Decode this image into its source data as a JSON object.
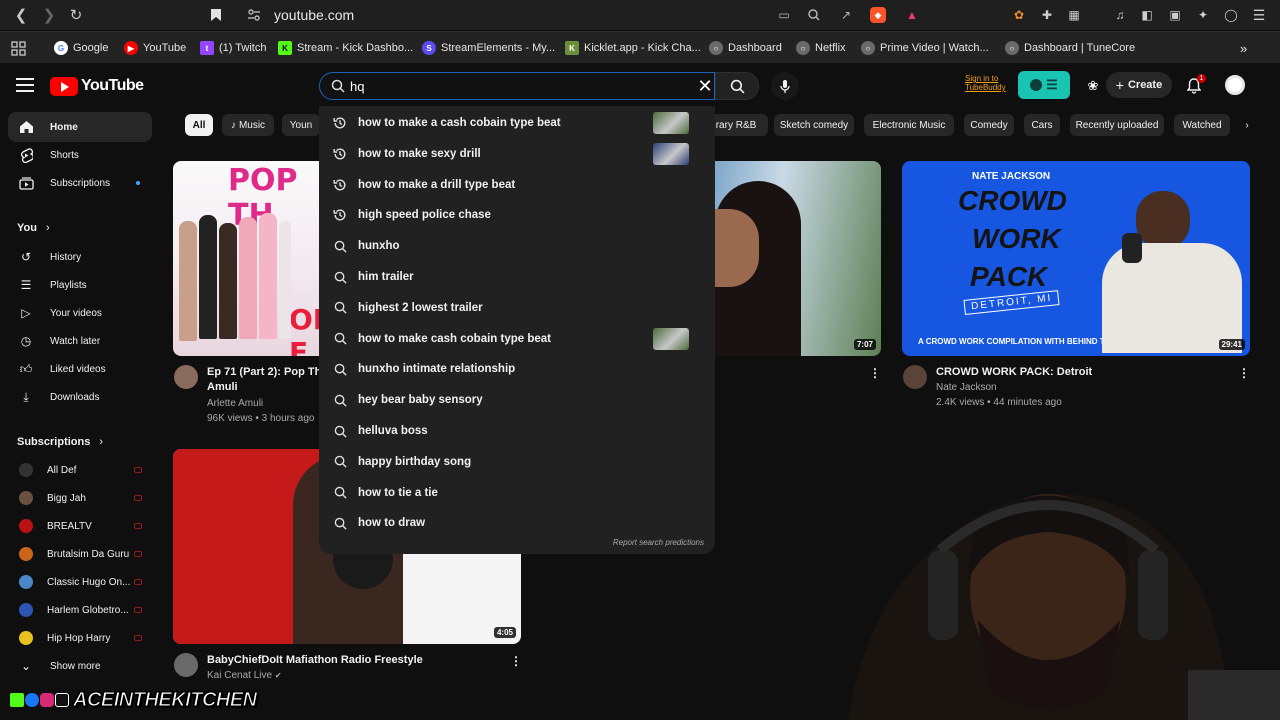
{
  "browser": {
    "url": "youtube.com",
    "bookmarks": [
      {
        "label": "Google",
        "color": "#4285f4",
        "icon": "google-icon"
      },
      {
        "label": "YouTube",
        "color": "#ff0000",
        "icon": "youtube-icon"
      },
      {
        "label": "(1) Twitch",
        "color": "#9146ff",
        "icon": "twitch-icon"
      },
      {
        "label": "Stream - Kick Dashbo...",
        "color": "#53fc18",
        "icon": "kick-icon"
      },
      {
        "label": "StreamElements - My...",
        "color": "#5b4cf0",
        "icon": "streamelements-icon"
      },
      {
        "label": "Kicklet.app - Kick Cha...",
        "color": "#6b8f3a",
        "icon": "kicklet-icon"
      },
      {
        "label": "Dashboard",
        "color": "#8a8a8a",
        "icon": "globe-icon"
      },
      {
        "label": "Netflix",
        "color": "#8a8a8a",
        "icon": "globe-icon"
      },
      {
        "label": "Prime Video | Watch...",
        "color": "#8a8a8a",
        "icon": "globe-icon"
      },
      {
        "label": "Dashboard | TuneCore",
        "color": "#8a8a8a",
        "icon": "globe-icon"
      }
    ]
  },
  "header": {
    "logo_text": "YouTube",
    "search_value": "hq",
    "tubebuddy_line1": "Sign in to",
    "tubebuddy_line2": "TubeBuddy",
    "create_label": "Create",
    "notification_count": "1"
  },
  "sidebar": {
    "main": [
      {
        "label": "Home",
        "icon": "home-icon"
      },
      {
        "label": "Shorts",
        "icon": "shorts-icon"
      },
      {
        "label": "Subscriptions",
        "icon": "subscriptions-icon"
      }
    ],
    "you_heading": "You",
    "you_items": [
      {
        "label": "History",
        "icon": "history-icon"
      },
      {
        "label": "Playlists",
        "icon": "playlists-icon"
      },
      {
        "label": "Your videos",
        "icon": "your-videos-icon"
      },
      {
        "label": "Watch later",
        "icon": "watch-later-icon"
      },
      {
        "label": "Liked videos",
        "icon": "liked-videos-icon"
      },
      {
        "label": "Downloads",
        "icon": "downloads-icon"
      }
    ],
    "subs_heading": "Subscriptions",
    "subs": [
      {
        "label": "All Def",
        "color": "#333"
      },
      {
        "label": "Bigg Jah",
        "color": "#6b5040"
      },
      {
        "label": "BREALTV",
        "color": "#b11"
      },
      {
        "label": "Brutalsim Da Guru",
        "color": "#c9641b"
      },
      {
        "label": "Classic Hugo On...",
        "color": "#4a86c8"
      },
      {
        "label": "Harlem Globetro...",
        "color": "#2a55b0"
      },
      {
        "label": "Hip Hop Harry",
        "color": "#e8c020"
      }
    ],
    "show_more": "Show more"
  },
  "chips": [
    {
      "label": "All"
    },
    {
      "label": "Music"
    },
    {
      "label": "Youn"
    },
    {
      "label": "rary R&B"
    },
    {
      "label": "Sketch comedy"
    },
    {
      "label": "Electronic Music"
    },
    {
      "label": "Comedy"
    },
    {
      "label": "Cars"
    },
    {
      "label": "Recently uploaded"
    },
    {
      "label": "Watched"
    }
  ],
  "videos": [
    {
      "title_line1": "Ep 71 (Part 2): Pop Th",
      "title_line2": "Amuli",
      "channel": "Arlette Amuli",
      "stats": "96K views • 3 hours ago",
      "thumb_text": "POP TH",
      "thumb_text2": "OR F"
    },
    {
      "duration": "7:07"
    },
    {
      "title_line1": "CROWD WORK PACK: Detroit",
      "channel": "Nate Jackson",
      "stats": "2.4K views • 44 minutes ago",
      "duration": "29:41",
      "thumb_name": "NATE JACKSON",
      "thumb_title1": "CROWD",
      "thumb_title2": "WORK",
      "thumb_title3": "PACK",
      "thumb_sub": "DETROIT, MI",
      "thumb_caption": "A CROWD WORK COMPILATION WITH BEHIND THE SCENES"
    },
    {
      "title_line1": "BabyChiefDoIt Mafiathon Radio Freestyle",
      "channel": "Kai Cenat Live",
      "duration": "4:05"
    }
  ],
  "suggestions": [
    {
      "text": "how to make a cash cobain type beat",
      "type": "history",
      "thumb": true,
      "thumb_color": "#4a6a3a"
    },
    {
      "text": "how to make sexy drill",
      "type": "history",
      "thumb": true,
      "thumb_color": "#2a3e78"
    },
    {
      "text": "how to make a drill type beat",
      "type": "history",
      "thumb": false
    },
    {
      "text": "high speed police chase",
      "type": "history",
      "thumb": false
    },
    {
      "text": "hunxho",
      "type": "search",
      "thumb": false
    },
    {
      "text": "him trailer",
      "type": "search",
      "thumb": false
    },
    {
      "text": "highest 2 lowest trailer",
      "type": "search",
      "thumb": false
    },
    {
      "text": "how to make cash cobain type beat",
      "type": "search",
      "thumb": true,
      "thumb_color": "#4a6a3a"
    },
    {
      "text": "hunxho intimate relationship",
      "type": "search",
      "thumb": false
    },
    {
      "text": "hey bear baby sensory",
      "type": "search",
      "thumb": false
    },
    {
      "text": "helluva boss",
      "type": "search",
      "thumb": false
    },
    {
      "text": "happy birthday song",
      "type": "search",
      "thumb": false
    },
    {
      "text": "how to tie a tie",
      "type": "search",
      "thumb": false
    },
    {
      "text": "how to draw",
      "type": "search",
      "thumb": false
    }
  ],
  "report_label": "Report search predictions",
  "overlay": {
    "watermark": "ACEINTHEKITCHEN"
  },
  "colors": {
    "accent": "#ff0000",
    "search_focus": "#1c62b9",
    "tubebuddy": "#19c5b2"
  }
}
